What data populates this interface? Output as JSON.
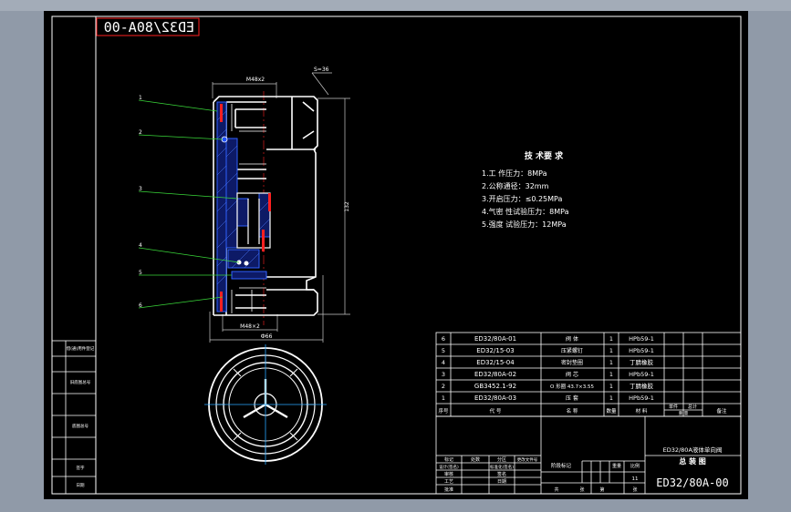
{
  "drawing": {
    "number_mirrored": "ED32/80A-00",
    "drawing_number": "ED32/80A-00",
    "product_name": "ED32/80A液体单向阀",
    "drawing_title": "总 装 图",
    "sheet_count": "11"
  },
  "dimensions": {
    "top_thread": "M48x2",
    "hex_size": "S=36",
    "height": "132",
    "bottom_thread": "M48×2",
    "diameter": "Ф66"
  },
  "callouts": [
    "1",
    "2",
    "3",
    "4",
    "5",
    "6"
  ],
  "technical_requirements": {
    "title": "技 术要 求",
    "items": [
      "1.工 作压力：8MPa",
      "2.公称通径：32mm",
      "3.开启压力：≤0.25MPa",
      "4.气密 性试验压力：8MPa",
      "5.强度 试验压力：12MPa"
    ]
  },
  "parts_list": {
    "rows": [
      {
        "seq": "6",
        "code": "ED32/80A-01",
        "name": "阀    体",
        "qty": "1",
        "material": "HPb59-1"
      },
      {
        "seq": "5",
        "code": "ED32/15-03",
        "name": "压紧螺钉",
        "qty": "1",
        "material": "HPb59-1"
      },
      {
        "seq": "4",
        "code": "ED32/15-04",
        "name": "密封垫圈",
        "qty": "1",
        "material": "丁腈橡胶"
      },
      {
        "seq": "3",
        "code": "ED32/80A-02",
        "name": "阀    芯",
        "qty": "1",
        "material": "HPb59-1"
      },
      {
        "seq": "2",
        "code": "GB3452.1-92",
        "name": "O 形圈 43.7×3.55",
        "qty": "1",
        "material": "丁腈橡胶"
      },
      {
        "seq": "1",
        "code": "ED32/80A-03",
        "name": "压    套",
        "qty": "1",
        "material": "HPb59-1"
      }
    ],
    "header": {
      "seq": "序号",
      "code": "代    号",
      "name": "名    称",
      "qty": "数量",
      "material": "材    料",
      "unit_weight": "单件",
      "total_weight": "总计",
      "weight_label": "重 量",
      "remark": "备注"
    }
  },
  "left_strip": [
    "借(通)用件登记",
    "旧底图总号",
    "底图总号",
    "签字",
    "日期"
  ],
  "title_block": {
    "design": "设计(签名)",
    "std": "标准化(签名)",
    "review": "审核",
    "craft": "工艺",
    "date": "日期",
    "approve": "批准",
    "mark": "标记",
    "count": "处数",
    "zone": "分区",
    "change_doc": "更改文件号",
    "sign": "签名",
    "stage": "阶段标记",
    "weight": "重量",
    "scale": "比例",
    "total": "共",
    "zhang": "张",
    "page": "第",
    "page_zhang": "张"
  }
}
